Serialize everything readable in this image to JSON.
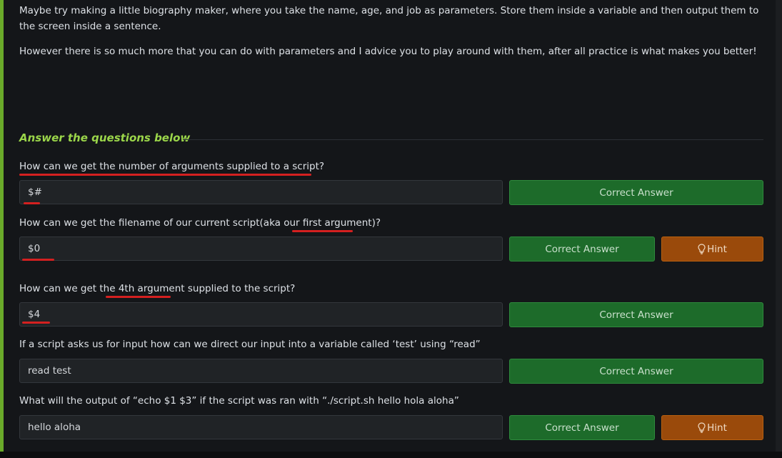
{
  "intro": {
    "paragraph_1": "Maybe try making a little biography maker, where you take the name, age, and job as parameters. Store them inside a variable and then output them to the screen inside a sentence.",
    "paragraph_2": "However there is so much more that you can do with parameters and I advice you to play around with them, after all practice is what makes you better!"
  },
  "section": {
    "heading": "Answer the questions below"
  },
  "questions": [
    {
      "text": "How can we get the number of arguments supplied to a script?",
      "answer": "$#",
      "button_label": "Correct Answer"
    },
    {
      "text": "How can we get the filename of our current script(aka our first argument)?",
      "answer": "$0",
      "button_label": "Correct Answer",
      "hint_label": "Hint"
    },
    {
      "text": "How can we get the 4th argument supplied to the script?",
      "answer": "$4",
      "button_label": "Correct Answer"
    },
    {
      "text": "If a script asks us for input how can we direct our input into a variable called ‘test’ using “read”",
      "answer": "read test",
      "button_label": "Correct Answer"
    },
    {
      "text": "What will the output of “echo $1 $3” if the script was ran with “./script.sh hello hola aloha”",
      "answer": "hello aloha",
      "button_label": "Correct Answer",
      "hint_label": "Hint"
    }
  ],
  "colors": {
    "accent_bar": "#6aaa2a",
    "heading": "#9bd64a",
    "correct_button": "#1d6b2a",
    "hint_button": "#9a4a0b",
    "annotation_underline": "#d42020"
  },
  "icons": {
    "hint": "lightbulb-icon"
  }
}
